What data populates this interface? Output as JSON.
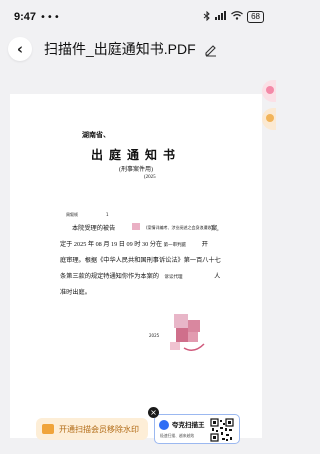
{
  "status_bar": {
    "time": "9:47",
    "dots": "•••",
    "battery": "68"
  },
  "header": {
    "title": "扫描件_出庭通知书.PDF"
  },
  "document": {
    "court": "湖南省、",
    "heading": "出庭通知书",
    "case_type": "(刑事案件用)",
    "year_ref": "(2025",
    "recipient_label": "周叙帧",
    "recipient_mark": "1",
    "line1_prefix": "本院受理的被告",
    "line1_note": "(案情详编考、涉业阅述之会身浪遭收)",
    "line1_end": "案,",
    "line2": [
      "定于",
      "2025",
      "年",
      "08",
      "月",
      "19",
      "日",
      "09",
      "时",
      "30",
      "分在",
      "第一审判庭",
      "开"
    ],
    "line3": "庭审理。根据《中华人民共和国刑事诉讼法》第一百八十七",
    "line4_prefix": "条第三款的规定特通知你作为本案的",
    "line4_role": "诉讼代理",
    "line4_end": "人",
    "line5": "准时出庭。",
    "sign_year": "2025"
  },
  "watermark_button": {
    "label": "开通扫描会员移除水印"
  },
  "promo": {
    "name": "夸克扫描王",
    "sub": "极速扫描、越来越效"
  },
  "colors": {
    "accent": "#2f6ef5",
    "watermark_bg": "#fdeed7",
    "watermark_text": "#b16a14"
  }
}
